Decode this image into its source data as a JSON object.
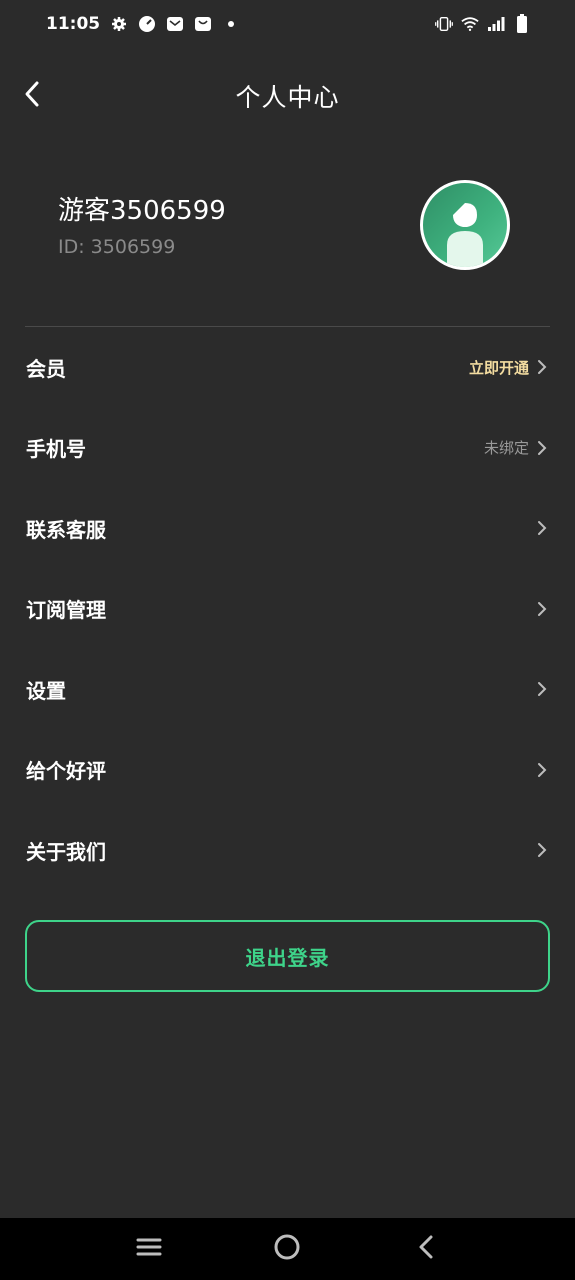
{
  "status_bar": {
    "time": "11:05",
    "left_icons": [
      "gear-icon",
      "speedometer-icon",
      "mail-icon",
      "bag-icon",
      "dot-icon"
    ],
    "right_icons": [
      "vibrate-icon",
      "wifi-icon",
      "signal-icon",
      "battery-icon"
    ]
  },
  "header": {
    "title": "个人中心",
    "back_icon": "chevron-left-icon"
  },
  "profile": {
    "username": "游客3506599",
    "user_id": "ID: 3506599"
  },
  "menu": {
    "items": [
      {
        "label": "会员",
        "value": "立即开通"
      },
      {
        "label": "手机号",
        "value": "未绑定"
      },
      {
        "label": "联系客服",
        "value": ""
      },
      {
        "label": "订阅管理",
        "value": ""
      },
      {
        "label": "设置",
        "value": ""
      },
      {
        "label": "给个好评",
        "value": ""
      },
      {
        "label": "关于我们",
        "value": ""
      }
    ]
  },
  "logout": {
    "label": "退出登录"
  },
  "colors": {
    "background": "#2b2b2b",
    "accent": "#3ed48a",
    "vip_gold": "#f3dca0",
    "muted": "#9a9a9a"
  },
  "nav_bar": {
    "icons": [
      "recent-apps-icon",
      "home-icon",
      "back-icon"
    ]
  }
}
